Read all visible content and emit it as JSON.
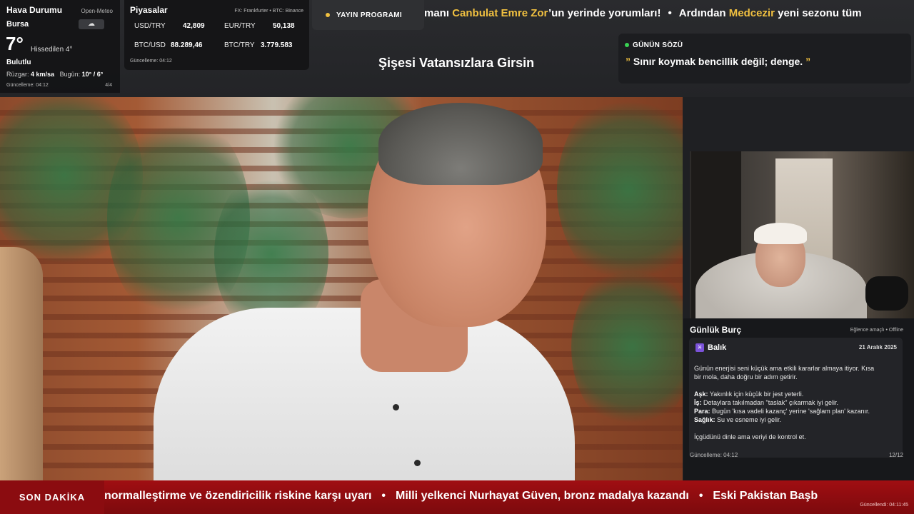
{
  "weather": {
    "title": "Hava Durumu",
    "source": "Open-Meteo",
    "city": "Bursa",
    "icon": "cloud-icon",
    "temperature": "7°",
    "feels_like": "Hissedilen 4°",
    "condition": "Bulutlu",
    "wind_label": "Rüzgar:",
    "wind_value": "4 km/sa",
    "today_label": "Bugün:",
    "today_value": "10° / 6°",
    "updated": "Güncelleme: 04:12",
    "page": "4/4"
  },
  "markets": {
    "title": "Piyasalar",
    "source": "FX: Frankfurter • BTC: Binance",
    "rows": [
      {
        "label": "USD/TRY",
        "value": "42,809"
      },
      {
        "label": "EUR/TRY",
        "value": "50,138"
      },
      {
        "label": "BTC/USD",
        "value": "88.289,46"
      },
      {
        "label": "BTC/TRY",
        "value": "3.779.583"
      }
    ],
    "updated": "Güncelleme: 04:12"
  },
  "schedule": {
    "label": "YAYIN PROGRAMI",
    "dot_color": "#f0c040"
  },
  "top_ticker": {
    "parts": [
      {
        "text": "manı ",
        "highlight": false
      },
      {
        "text": "Canbulat Emre Zor",
        "highlight": true
      },
      {
        "text": "’un yerinde yorumları!",
        "highlight": false
      },
      {
        "text": "•",
        "highlight": false
      },
      {
        "text": "Ardından ",
        "highlight": false
      },
      {
        "text": "Medcezir",
        "highlight": true
      },
      {
        "text": " yeni sezonu tüm",
        "highlight": false
      }
    ],
    "highlight_color": "#f0c040"
  },
  "show_title": "Şişesi Vatansızlara Girsin",
  "quote": {
    "label": "GÜNÜN SÖZÜ",
    "open_mark": "”",
    "text": " Sınır koymak bencillik değil; denge. ",
    "close_mark": "”"
  },
  "horoscope": {
    "title": "Günlük Burç",
    "meta": "Eğlence amaçlı • Offline",
    "sign_symbol": "♓",
    "sign": "Balık",
    "date": "21 Aralık 2025",
    "intro_1": "Günün enerjisi seni küçük ama etkili kararlar almaya itiyor. Kısa",
    "intro_2": "bir mola, daha doğru bir adım getirir.",
    "love_label": "Aşk:",
    "love": " Yakınlık için küçük bir jest yeterli.",
    "work_label": "İş:",
    "work": " Detaylara takılmadan \"taslak\" çıkarmak iyi gelir.",
    "money_label": "Para:",
    "money": " Bugün 'kısa vadeli kazanç' yerine 'sağlam plan' kazanır.",
    "health_label": "Sağlık:",
    "health": " Su ve esneme iyi gelir.",
    "closing": "İçgüdünü dinle ama veriyi de kontrol et.",
    "updated": "Güncelleme: 04:12",
    "page": "12/12"
  },
  "breaking": {
    "label": "SON DAKİKA",
    "items": [
      "normalleştirme ve özendiricilik riskine karşı uyarı",
      "Milli yelkenci Nurhayat Güven, bronz madalya kazandı",
      "Eski Pakistan Başb"
    ],
    "separator": "•",
    "updated": "Güncellendi: 04:11:45"
  }
}
